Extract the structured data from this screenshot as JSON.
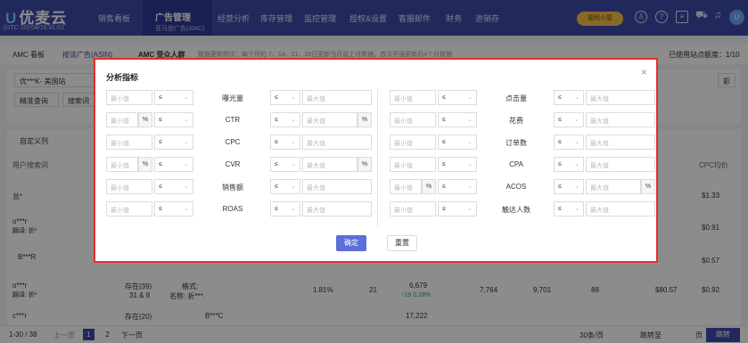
{
  "nav": {
    "logo": "优麦云",
    "time": "(UTC-10):04/16 01:01",
    "items": [
      "销售看板",
      "经营分析",
      "库存管理",
      "监控管理",
      "授权&设置",
      "客服邮件",
      "财务",
      "进销存"
    ],
    "active": "广告管理",
    "active_sub": "亚马逊广告(AMC)",
    "promo": "福利小屋"
  },
  "toolbar": {
    "amc_board": "AMC 看板",
    "tab_asin": "按该广告(ASIN)",
    "tab_audience": "AMC 受众人群",
    "note": "数据更新频次：每个月的 7、14、21、28日更新当月前上月数据，首次开通更新后4个月数据",
    "quota": "已使用站点额度：1/10"
  },
  "filters": {
    "store": "优***K- 美国站",
    "match": "精准查询",
    "search_placeholder": "搜索词",
    "right_btn": "影"
  },
  "table": {
    "custom_cols": "自定义列",
    "col_search_term": "用户搜索词",
    "col_cpc": "CPC均价",
    "total": "总*",
    "rows": [
      {
        "term": "o***r",
        "sub": "翻译: 折*",
        "cpc": "$0.91",
        "left": "46"
      },
      {
        "term": "B***R",
        "sub": "",
        "cpc": "$0.57",
        "left": "57"
      },
      {
        "term": "o***r",
        "sub": "翻译: 折*",
        "stock": "存在(39)",
        "stock_sub": "31 & 8",
        "fmt": "格式:",
        "name": "名称: 折***.",
        "c1": "1.81%",
        "c2": "21",
        "c3": "6,679",
        "c3_sub": "↑19  0.28%",
        "c4": "7,764",
        "c5": "9,701",
        "c6": "88",
        "c7": "$80.57",
        "cpc": "$0.92"
      },
      {
        "term": "c***r",
        "stock": "存在(20)",
        "brand": "B***C",
        "c3": "17,222"
      }
    ],
    "total_cpc": "$1.33"
  },
  "pager": {
    "range": "1-30 / 38",
    "prev": "上一页",
    "page1": "1",
    "page2": "2",
    "next": "下一页",
    "per_page": "30条/页",
    "jump": "跳转至",
    "page_unit": "页",
    "go": "跳转"
  },
  "modal": {
    "title": "分析指标",
    "min_ph": "最小值",
    "max_ph": "最大值",
    "op": "≤",
    "pct": "%",
    "left_metrics": [
      {
        "label": "曝光量",
        "pct_min": false,
        "pct_max": false
      },
      {
        "label": "CTR",
        "pct_min": true,
        "pct_max": true
      },
      {
        "label": "CPC",
        "pct_min": false,
        "pct_max": false
      },
      {
        "label": "CVR",
        "pct_min": true,
        "pct_max": true
      },
      {
        "label": "销售额",
        "pct_min": false,
        "pct_max": false
      },
      {
        "label": "ROAS",
        "pct_min": false,
        "pct_max": false
      }
    ],
    "right_metrics": [
      {
        "label": "点击量",
        "pct_min": false,
        "pct_max": false
      },
      {
        "label": "花费",
        "pct_min": false,
        "pct_max": false
      },
      {
        "label": "订单数",
        "pct_min": false,
        "pct_max": false
      },
      {
        "label": "CPA",
        "pct_min": false,
        "pct_max": false
      },
      {
        "label": "ACOS",
        "pct_min": true,
        "pct_max": true
      },
      {
        "label": "触达人数",
        "pct_min": false,
        "pct_max": false
      }
    ],
    "confirm": "确定",
    "reset": "重置"
  }
}
